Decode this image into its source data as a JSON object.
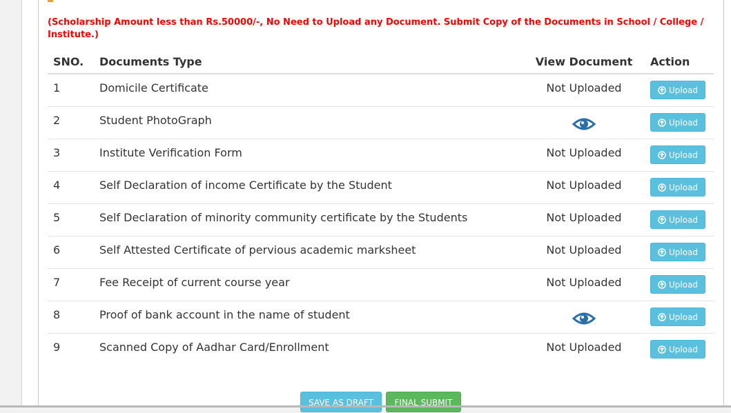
{
  "notice": "(Scholarship Amount less than Rs.50000/-, No Need to Upload any Document. Submit Copy of the Documents in School / College / Institute.)",
  "table": {
    "headers": {
      "sno": "SNO.",
      "type": "Documents Type",
      "view": "View Document",
      "action": "Action"
    },
    "rows": [
      {
        "sno": "1",
        "type": "Domicile Certificate",
        "view": "Not Uploaded",
        "action": "Upload"
      },
      {
        "sno": "2",
        "type": "Student PhotoGraph",
        "view": "eye-icon",
        "action": "Upload"
      },
      {
        "sno": "3",
        "type": "Institute Verification Form",
        "view": "Not Uploaded",
        "action": "Upload"
      },
      {
        "sno": "4",
        "type": "Self Declaration of income Certificate by the Student",
        "view": "Not Uploaded",
        "action": "Upload"
      },
      {
        "sno": "5",
        "type": "Self Declaration of minority community certificate by the Students",
        "view": "Not Uploaded",
        "action": "Upload"
      },
      {
        "sno": "6",
        "type": "Self Attested Certificate of pervious academic marksheet",
        "view": "Not Uploaded",
        "action": "Upload"
      },
      {
        "sno": "7",
        "type": "Fee Receipt of current course year",
        "view": "Not Uploaded",
        "action": "Upload"
      },
      {
        "sno": "8",
        "type": "Proof of bank account in the name of student",
        "view": "eye-icon",
        "action": "Upload"
      },
      {
        "sno": "9",
        "type": "Scanned Copy of Aadhar Card/Enrollment",
        "view": "Not Uploaded",
        "action": "Upload"
      }
    ]
  },
  "buttons": {
    "save_draft": "SAVE AS DRAFT",
    "final_submit": "FINAL SUBMIT"
  },
  "colors": {
    "notice": "#ff0000",
    "upload_button": "#5bc0de",
    "eye_icon": "#2a6fa8",
    "submit_button": "#5cb85c"
  }
}
